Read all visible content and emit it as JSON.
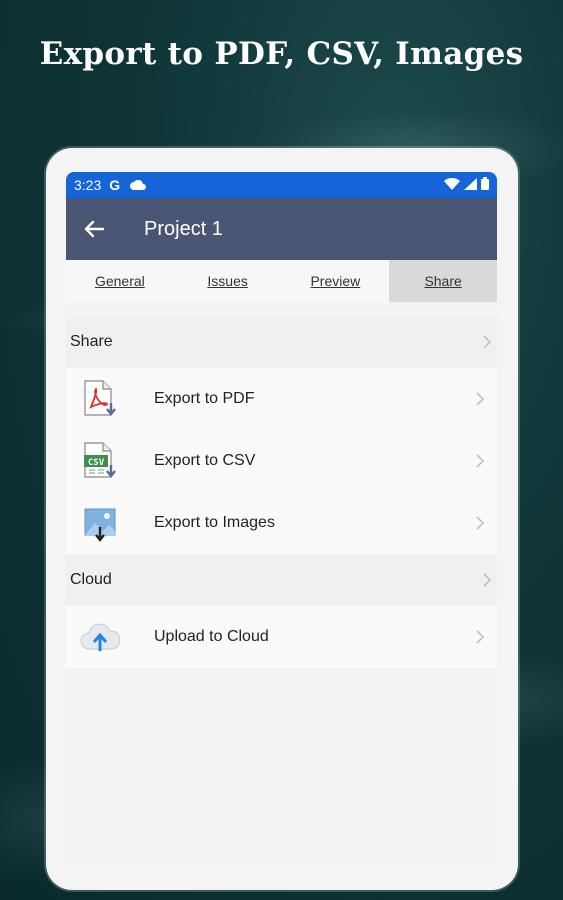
{
  "headline": "Export to PDF, CSV, Images",
  "status_bar": {
    "time": "3:23",
    "g_label": "G"
  },
  "app_bar": {
    "title": "Project 1"
  },
  "tabs": [
    {
      "label": "General"
    },
    {
      "label": "Issues"
    },
    {
      "label": "Preview"
    },
    {
      "label": "Share",
      "active": true
    }
  ],
  "sections": {
    "share": {
      "label": "Share",
      "items": [
        {
          "label": "Export to PDF",
          "icon": "pdf-file-icon"
        },
        {
          "label": "Export to CSV",
          "icon": "csv-file-icon"
        },
        {
          "label": "Export to Images",
          "icon": "image-file-icon"
        }
      ]
    },
    "cloud": {
      "label": "Cloud",
      "items": [
        {
          "label": "Upload to Cloud",
          "icon": "cloud-upload-icon"
        }
      ]
    }
  },
  "colors": {
    "status_bar": "#1565d8",
    "app_bar": "#4a5573",
    "background": "#0f3537"
  }
}
